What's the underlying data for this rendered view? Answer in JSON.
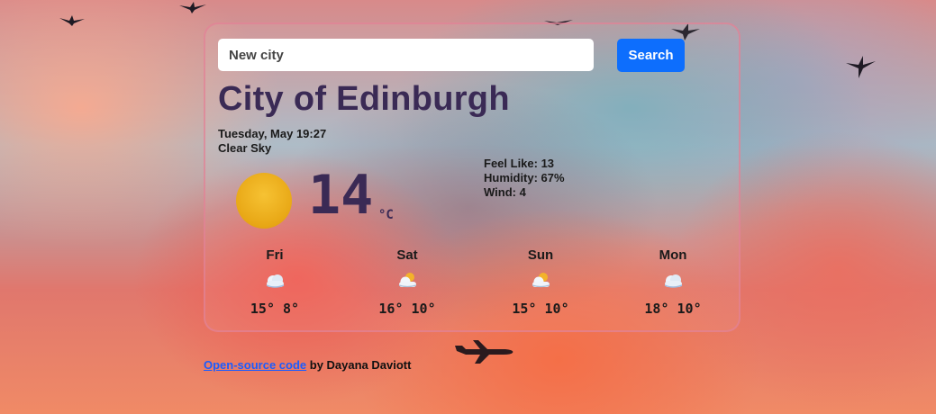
{
  "search": {
    "placeholder": "New city",
    "button_label": "Search"
  },
  "current": {
    "city": "City of Edinburgh",
    "date": "Tuesday, May 19:27",
    "description": "Clear Sky",
    "temperature": "14",
    "unit": "°C",
    "icon": "sun-icon",
    "feels_like": "Feel Like: 13",
    "humidity": "Humidity: 67%",
    "wind": "Wind: 4"
  },
  "forecast": [
    {
      "day": "Fri",
      "temps": "15° 8°",
      "icon": "cloudy-icon"
    },
    {
      "day": "Sat",
      "temps": "16° 10°",
      "icon": "partly-sunny-icon"
    },
    {
      "day": "Sun",
      "temps": "15° 10°",
      "icon": "partly-sunny-icon"
    },
    {
      "day": "Mon",
      "temps": "18° 10°",
      "icon": "cloudy-icon"
    }
  ],
  "footer": {
    "link_text": "Open-source code",
    "suffix": " by Dayana Daviott"
  },
  "colors": {
    "accent": "#0d6efd",
    "city_text": "#3a2a55",
    "sun": "#f2b824"
  }
}
